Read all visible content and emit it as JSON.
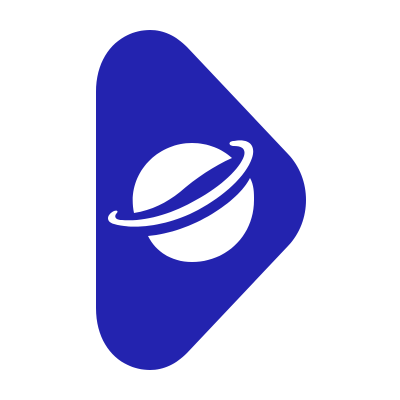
{
  "logo": {
    "name": "play-button-planet-logo",
    "icon": "play-planet-icon",
    "colors": {
      "primary": "#2323AF",
      "secondary": "#FFFFFF",
      "background": "#FFFFFF"
    }
  }
}
